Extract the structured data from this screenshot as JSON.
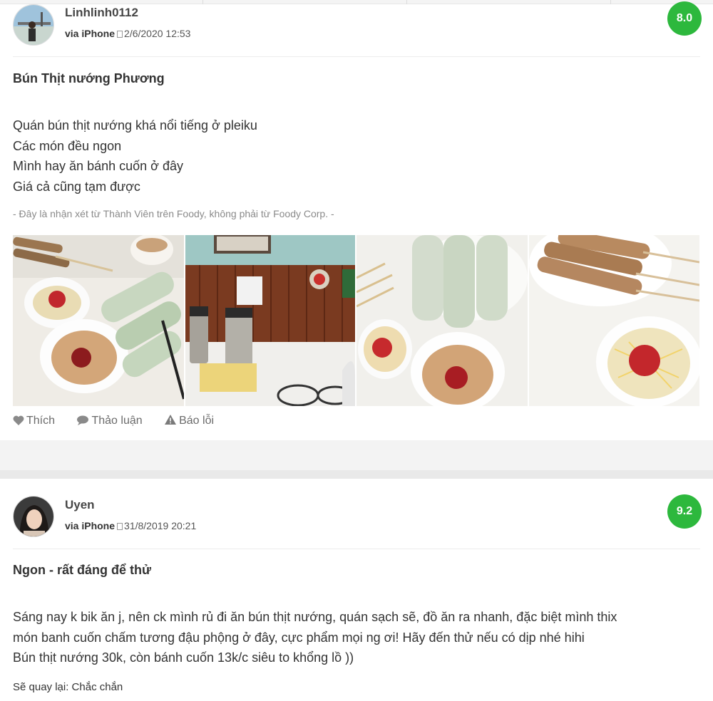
{
  "reviews": [
    {
      "username": "Linhlinh0112",
      "via": "via iPhone",
      "datetime": "2/6/2020 12:53",
      "score": "8.0",
      "title": "Bún Thịt nướng Phương",
      "lines": [
        "Quán bún thịt nướng khá nổi tiếng ở pleiku",
        "Các món đều ngon",
        "Mình hay ăn bánh cuốn ở đây",
        "Giá cả cũng tạm được"
      ],
      "disclaimer": "- Đây là nhận xét từ Thành Viên trên Foody, không phải từ Foody Corp. -",
      "actions": {
        "like": "Thích",
        "discuss": "Thảo luận",
        "report": "Báo lỗi"
      }
    },
    {
      "username": "Uyen",
      "via": "via iPhone",
      "datetime": "31/8/2019 20:21",
      "score": "9.2",
      "title": "Ngon - rất đáng để thử",
      "lines": [
        "Sáng nay k bik ăn j, nên ck mình rủ đi ăn bún thịt nướng, quán sạch sẽ, đồ ăn ra nhanh, đặc biệt mình thix",
        "món banh cuốn chấm tương đậu phộng ở đây, cực phẩm mọi ng ơi! Hãy đến thử nếu có dịp nhé hihi",
        "Bún thịt nướng 30k, còn bánh cuốn 13k/c siêu to khổng lồ ))"
      ],
      "return_label": "Sẽ quay lại: Chắc chắn"
    }
  ],
  "colors": {
    "score_green": "#2db83d",
    "text": "#333333",
    "muted": "#8a8a8a"
  },
  "icons": [
    "heart-icon",
    "speech-bubble-icon",
    "warning-icon"
  ]
}
